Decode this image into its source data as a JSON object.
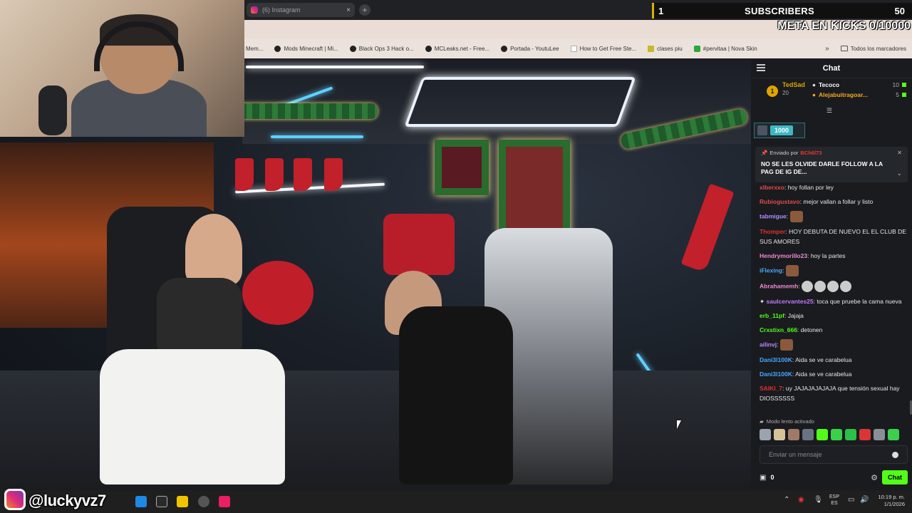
{
  "browser": {
    "tab_title": "(6) Instagram",
    "bookmarks": [
      {
        "label": "Mem..."
      },
      {
        "label": "Mods Minecraft | Mi..."
      },
      {
        "label": "Black Ops 3 Hack o..."
      },
      {
        "label": "MCLeaks.net - Free..."
      },
      {
        "label": "Portada - YoutuLee"
      },
      {
        "label": "How to Get Free Ste..."
      },
      {
        "label": "clases piu"
      },
      {
        "label": "#pervitaa | Nova Skin"
      }
    ],
    "all_bookmarks": "Todos los marcadores"
  },
  "overlay": {
    "subs_count": "1",
    "subs_label": "SUBSCRIBERS",
    "subs_goal": "50",
    "meta_text": "META EN KICKS 0/10000"
  },
  "chat": {
    "title": "Chat",
    "leader_rank": "1",
    "leader_name": "TedSad",
    "leader_count": "20",
    "top2_name": "Tecoco",
    "top2_count": "10",
    "top3_name": "Alejabuitragoar...",
    "top3_count": "5",
    "gift_amount": "1000",
    "pinned_by_label": "Enviado por",
    "pinned_user": "BCh6l73",
    "pinned_text": "NO SE LES OLVIDE DARLE FOLLOW A LA PAG DE IG DE...",
    "messages": [
      {
        "user": "xlberxxo",
        "color": "#e04b4b",
        "text": "hoy follan por ley"
      },
      {
        "user": "Rubiogustavo",
        "color": "#e04b4b",
        "text": "mejor vallan a follar y listo"
      },
      {
        "user": "tabmigue",
        "color": "#b58cff",
        "text": ""
      },
      {
        "user": "Thomper",
        "color": "#e03030",
        "text": "HOY DEBUTA DE NUEVO EL EL CLUB DE SUS AMORES"
      },
      {
        "user": "Hendrymorillo23",
        "color": "#f08ad0",
        "text": "hoy la partes"
      },
      {
        "user": "iFlexing",
        "color": "#4aa8ff",
        "text": ""
      },
      {
        "user": "Abrahamemh",
        "color": "#f08ad0",
        "text": ""
      },
      {
        "user": "saulcervantes25",
        "color": "#c07bff",
        "text": "toca que pruebe la cama nueva"
      },
      {
        "user": "erb_11pf",
        "color": "#53fc18",
        "text": "Jajaja"
      },
      {
        "user": "Crxstixn_666",
        "color": "#53fc18",
        "text": "detonen"
      },
      {
        "user": "ailinvj",
        "color": "#b58cff",
        "text": ""
      },
      {
        "user": "Dani3l100K",
        "color": "#4aa8ff",
        "text": "Aida se ve carabelua"
      },
      {
        "user": "Dani3l100K",
        "color": "#4aa8ff",
        "text": "Aida se ve carabelua"
      },
      {
        "user": "SAIKI_7",
        "color": "#e03030",
        "text": "uy JAJAJAJAJAJA que tensión sexual hay DIOSSSSSS"
      }
    ],
    "slow_mode": "Modo lento activado",
    "input_placeholder": "Enviar un mensaje",
    "points": "0",
    "send_label": "Chat"
  },
  "taskbar": {
    "handle": "@luckyvz7",
    "lang_top": "ESP",
    "lang_bottom": "ES",
    "time": "10:19 p. m.",
    "date": "1/1/2026"
  },
  "colors": {
    "kick_green": "#53fc18",
    "chat_bg": "#191b1f",
    "subs_accent": "#d8b100"
  }
}
